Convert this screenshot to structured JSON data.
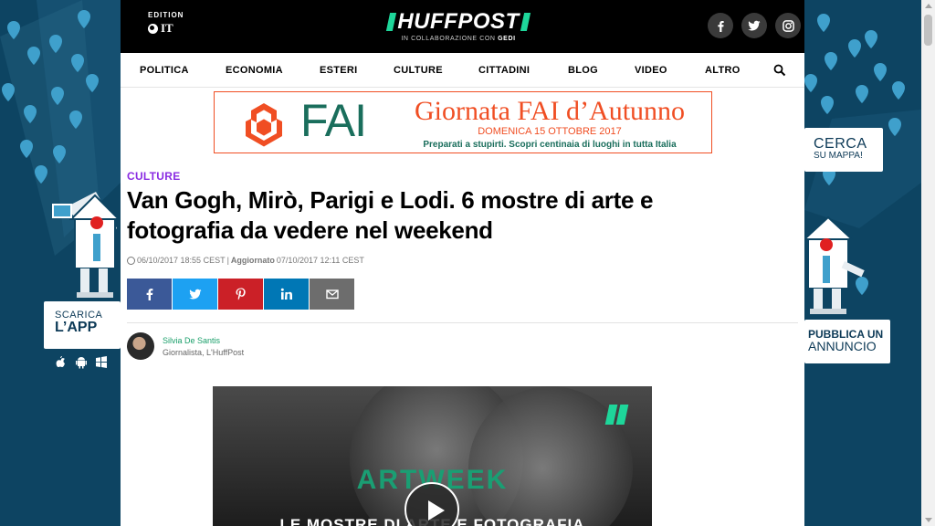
{
  "header": {
    "edition_label": "EDITION",
    "edition_value": "IT",
    "logo_text": "HUFFPOST",
    "logo_sub_prefix": "IN COLLABORAZIONE CON",
    "logo_sub_brand": "GEDI",
    "social": [
      "f",
      "t",
      "ig"
    ]
  },
  "nav": {
    "items": [
      "POLITICA",
      "ECONOMIA",
      "ESTERI",
      "CULTURE",
      "CITTADINI",
      "BLOG",
      "VIDEO",
      "ALTRO"
    ]
  },
  "ad": {
    "brand": "FAI",
    "title": "Giornata FAI d’Autunno",
    "date": "DOMENICA 15 OTTOBRE 2017",
    "tagline": "Preparati a stupirti. Scopri centinaia di luoghi in tutta Italia"
  },
  "skin": {
    "left_cta_line1": "SCARICA",
    "left_cta_line2": "L’APP",
    "right_top_line1": "CERCA",
    "right_top_line2": "SU MAPPA!",
    "right_bottom_line1": "PUBBLICA UN",
    "right_bottom_line2": "ANNUNCIO"
  },
  "article": {
    "kicker": "CULTURE",
    "headline": "Van Gogh, Mirò, Parigi e Lodi. 6 mostre di arte e fotografia da vedere nel weekend",
    "published": "06/10/2017 18:55 CEST",
    "separator": "|",
    "updated_label": "Aggiornato",
    "updated": "07/10/2017 12:11 CEST",
    "author_name": "Silvia De Santis",
    "author_role": "Giornalista, L'HuffPost"
  },
  "video": {
    "title": "ARTWEEK",
    "subtitle": "LE MOSTRE DI ARTE E FOTOGRAFIA"
  },
  "colors": {
    "brand_green": "#1ed69a",
    "kicker_purple": "#8a2be2",
    "fai_orange": "#f04e23",
    "fai_green": "#1a6e5c",
    "facebook": "#3b5998",
    "twitter": "#1da1f2",
    "pinterest": "#cb2027",
    "linkedin": "#0077b5",
    "email": "#6d6d6d"
  }
}
